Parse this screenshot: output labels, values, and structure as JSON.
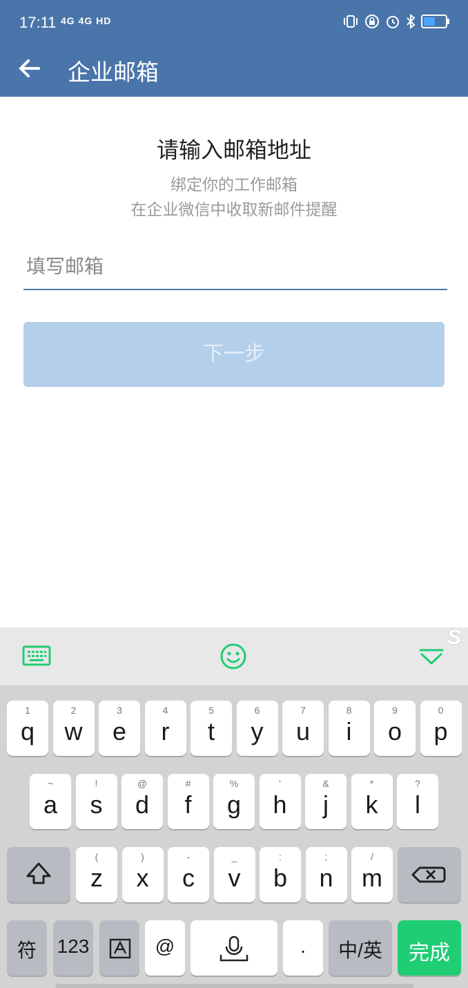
{
  "status_bar": {
    "time": "17:11",
    "signal_text": "4G 4G HD",
    "icons": [
      "vibrate-icon",
      "lock-rotation-icon",
      "alarm-icon",
      "bluetooth-icon",
      "battery-icon"
    ]
  },
  "app_bar": {
    "back_icon": "arrow-left-icon",
    "title": "企业邮箱"
  },
  "main": {
    "heading": "请输入邮箱地址",
    "subtitle_line1": "绑定你的工作邮箱",
    "subtitle_line2": "在企业微信中收取新邮件提醒",
    "email_input": {
      "value": "",
      "placeholder": "填写邮箱"
    },
    "next_button": "下一步"
  },
  "keyboard": {
    "toolbar": [
      "keyboard-icon",
      "emoji-icon",
      "collapse-icon"
    ],
    "row1": [
      {
        "key": "q",
        "hint": "1"
      },
      {
        "key": "w",
        "hint": "2"
      },
      {
        "key": "e",
        "hint": "3"
      },
      {
        "key": "r",
        "hint": "4"
      },
      {
        "key": "t",
        "hint": "5"
      },
      {
        "key": "y",
        "hint": "6"
      },
      {
        "key": "u",
        "hint": "7"
      },
      {
        "key": "i",
        "hint": "8"
      },
      {
        "key": "o",
        "hint": "9"
      },
      {
        "key": "p",
        "hint": "0"
      }
    ],
    "row2": [
      {
        "key": "a",
        "hint": "~"
      },
      {
        "key": "s",
        "hint": "!"
      },
      {
        "key": "d",
        "hint": "@"
      },
      {
        "key": "f",
        "hint": "#"
      },
      {
        "key": "g",
        "hint": "%"
      },
      {
        "key": "h",
        "hint": "'"
      },
      {
        "key": "j",
        "hint": "&"
      },
      {
        "key": "k",
        "hint": "*"
      },
      {
        "key": "l",
        "hint": "?"
      }
    ],
    "row3": [
      {
        "key": "z",
        "hint": "("
      },
      {
        "key": "x",
        "hint": ")"
      },
      {
        "key": "c",
        "hint": "-"
      },
      {
        "key": "v",
        "hint": "_"
      },
      {
        "key": "b",
        "hint": ":"
      },
      {
        "key": "n",
        "hint": ";"
      },
      {
        "key": "m",
        "hint": "/"
      }
    ],
    "bottom": {
      "symbols": "符",
      "numbers": "123",
      "at": "@",
      "period": ".",
      "lang": "中/英",
      "done": "完成"
    },
    "accent_color": "#1fcd75"
  }
}
